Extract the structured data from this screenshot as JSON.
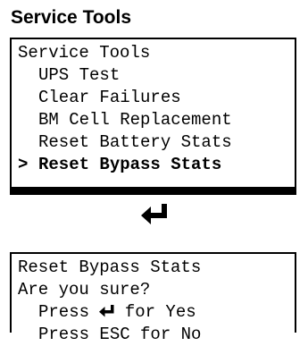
{
  "heading": "Service Tools",
  "menu": {
    "title": "Service Tools",
    "items": [
      {
        "label": "UPS Test"
      },
      {
        "label": "Clear Failures"
      },
      {
        "label": "BM Cell Replacement"
      },
      {
        "label": "Reset Battery Stats"
      },
      {
        "label": "Reset Bypass Stats",
        "selected": true
      }
    ],
    "cursor": ">"
  },
  "transition_icon": "enter-key-icon",
  "confirm": {
    "title": "Reset Bypass Stats",
    "question": "Are you sure?",
    "yes_prefix": "Press ",
    "yes_suffix": " for Yes",
    "no_line": "Press ESC for No"
  }
}
